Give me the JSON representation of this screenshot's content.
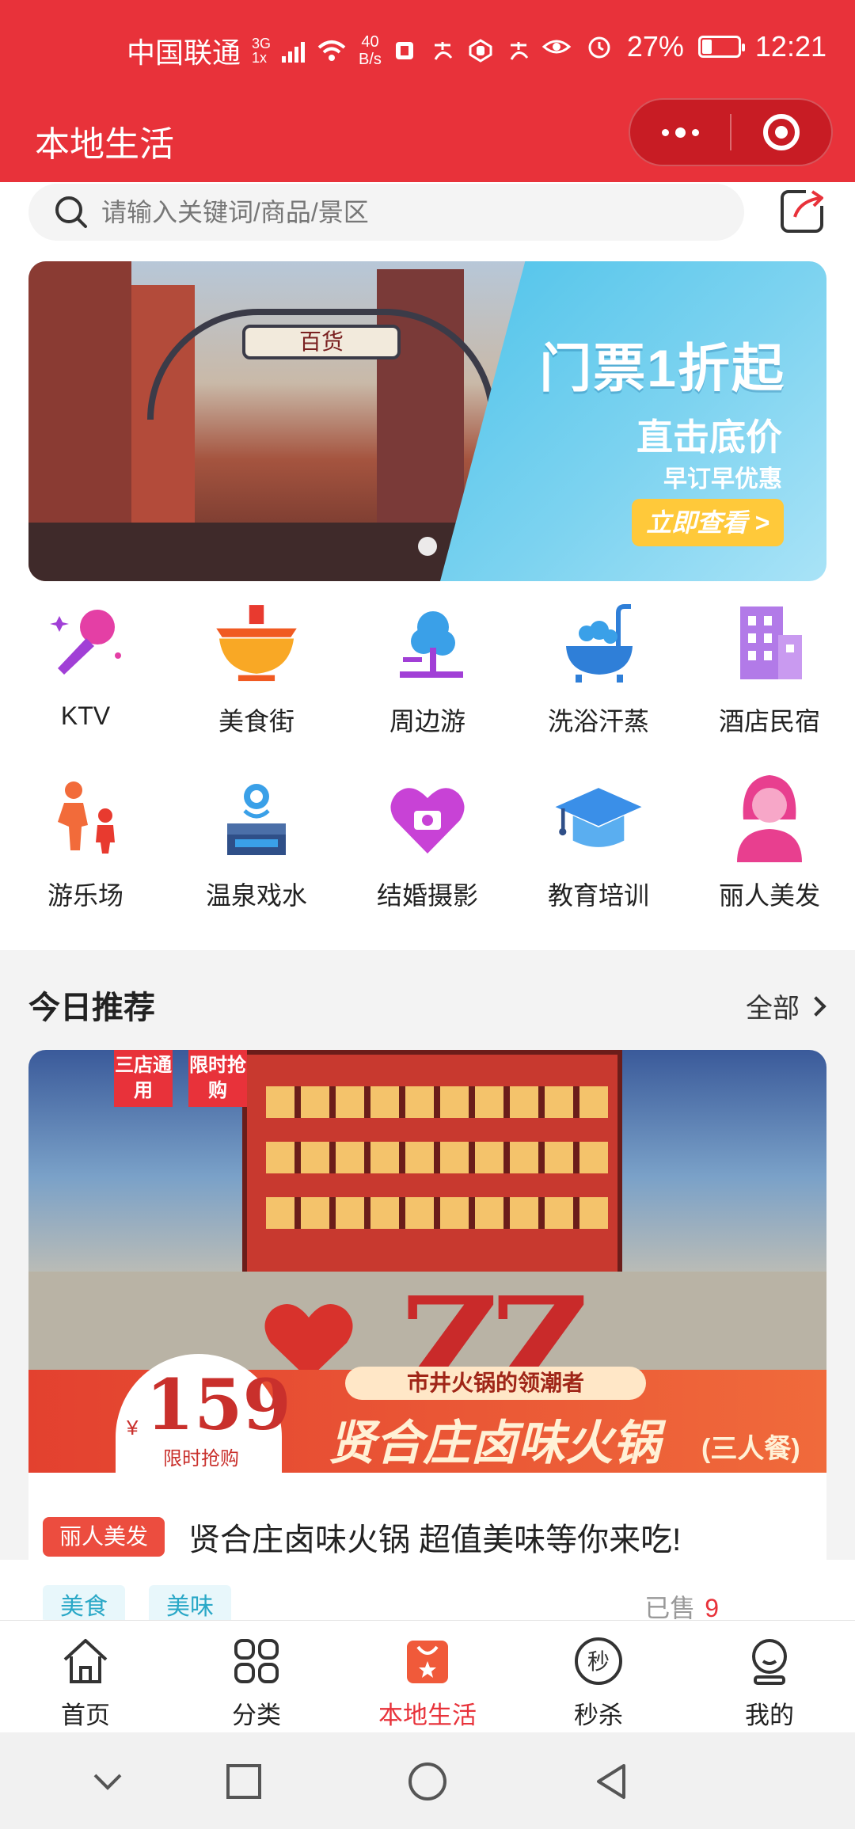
{
  "status_bar": {
    "carrier": "中国联通",
    "network": "3G",
    "network_sub": "1x",
    "speed_value": "40",
    "speed_unit": "B/s",
    "battery_percent": "27%",
    "battery_level": 0.27,
    "time": "12:21"
  },
  "title_bar": {
    "title": "本地生活",
    "more_icon": "more-dots-icon",
    "close_icon": "target-circle-icon"
  },
  "search": {
    "placeholder": "请输入关键词/商品/景区",
    "icon": "search-icon",
    "share_icon": "share-icon"
  },
  "banner": {
    "headline": "门票1折起",
    "subheading": "直击底价",
    "note": "早订早优惠",
    "cta": "立即查看 >",
    "street_sign": "百货",
    "active_slide": 1,
    "slide_count": 1,
    "colors": {
      "sky": "#4fc3ea",
      "cta": "#ffc93a"
    }
  },
  "categories": [
    {
      "label": "KTV",
      "icon": "microphone-icon"
    },
    {
      "label": "美食街",
      "icon": "hotpot-icon"
    },
    {
      "label": "周边游",
      "icon": "tree-icon"
    },
    {
      "label": "洗浴汗蒸",
      "icon": "bathtub-icon"
    },
    {
      "label": "酒店民宿",
      "icon": "building-icon"
    },
    {
      "label": "游乐场",
      "icon": "family-icon"
    },
    {
      "label": "温泉戏水",
      "icon": "hot-spring-icon"
    },
    {
      "label": "结婚摄影",
      "icon": "heart-camera-icon"
    },
    {
      "label": "教育培训",
      "icon": "graduation-cap-icon"
    },
    {
      "label": "丽人美发",
      "icon": "woman-avatar-icon"
    }
  ],
  "recommend": {
    "title": "今日推荐",
    "more": "全部",
    "card": {
      "poster": {
        "tag_left": "三店通用",
        "tag_right": "限时抢购",
        "slogan": "市井火锅的领潮者",
        "name": "贤合庄卤味火锅",
        "name_note": "(三人餐)",
        "price": "159",
        "currency": "¥",
        "price_note": "限时抢购",
        "letters": "ZZ"
      },
      "badge": "丽人美发",
      "title": "贤合庄卤味火锅 超值美味等你来吃!",
      "tags": [
        "美食",
        "美味"
      ],
      "sold_label": "已售",
      "sold_count": "9"
    }
  },
  "tabbar": [
    {
      "label": "首页",
      "icon": "home-icon",
      "active": false
    },
    {
      "label": "分类",
      "icon": "grid-icon",
      "active": false
    },
    {
      "label": "本地生活",
      "icon": "shopping-bag-icon",
      "active": true
    },
    {
      "label": "秒杀",
      "icon": "flash-sale-icon",
      "active": false
    },
    {
      "label": "我的",
      "icon": "profile-icon",
      "active": false
    }
  ],
  "colors": {
    "brand": "#e8323a",
    "tag_bg": "#e8f7fb",
    "tag_text": "#2aa8c7"
  }
}
